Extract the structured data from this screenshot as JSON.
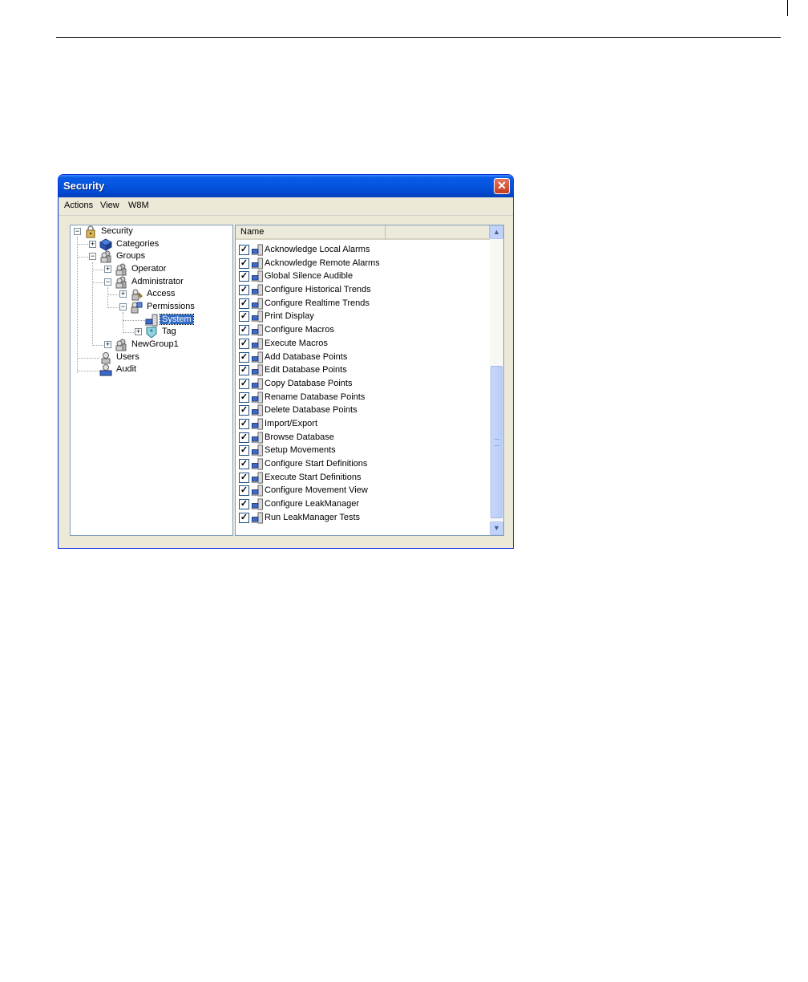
{
  "window": {
    "title": "Security",
    "close_glyph": "✕"
  },
  "menu": [
    "Actions",
    "View",
    "W8M"
  ],
  "tree": {
    "root": "Security",
    "categories": "Categories",
    "groups": "Groups",
    "operator": "Operator",
    "administrator": "Administrator",
    "access": "Access",
    "permissions": "Permissions",
    "system": "System",
    "tag": "Tag",
    "newgroup1": "NewGroup1",
    "users": "Users",
    "audit": "Audit",
    "expand_glyph": "+",
    "collapse_glyph": "−"
  },
  "list": {
    "column_name": "Name",
    "check_glyph": "✓",
    "rows": [
      "Acknowledge Local Alarms",
      "Acknowledge Remote Alarms",
      "Global Silence Audible",
      "Configure Historical Trends",
      "Configure Realtime Trends",
      "Print Display",
      "Configure Macros",
      "Execute Macros",
      "Add Database Points",
      "Edit Database Points",
      "Copy Database Points",
      "Rename Database Points",
      "Delete Database Points",
      "Import/Export",
      "Browse Database",
      "Setup Movements",
      "Configure Start Definitions",
      "Execute Start Definitions",
      "Configure Movement View",
      "Configure LeakManager",
      "Run LeakManager Tests"
    ]
  },
  "scroll": {
    "up_glyph": "▲",
    "down_glyph": "▼"
  },
  "colors": {
    "titlebar": "#0455df",
    "selection": "#316ac5",
    "window_face": "#ece9d8"
  }
}
